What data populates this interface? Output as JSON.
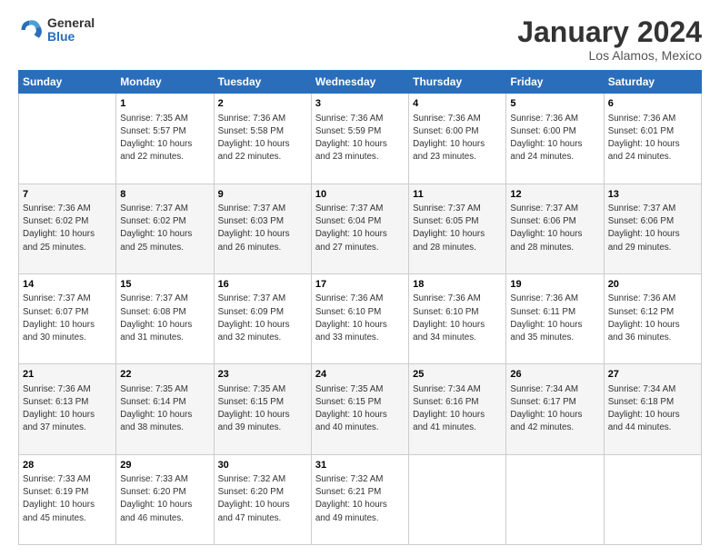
{
  "logo": {
    "general": "General",
    "blue": "Blue"
  },
  "title": "January 2024",
  "location": "Los Alamos, Mexico",
  "days_header": [
    "Sunday",
    "Monday",
    "Tuesday",
    "Wednesday",
    "Thursday",
    "Friday",
    "Saturday"
  ],
  "weeks": [
    [
      {
        "day": "",
        "info": ""
      },
      {
        "day": "1",
        "info": "Sunrise: 7:35 AM\nSunset: 5:57 PM\nDaylight: 10 hours\nand 22 minutes."
      },
      {
        "day": "2",
        "info": "Sunrise: 7:36 AM\nSunset: 5:58 PM\nDaylight: 10 hours\nand 22 minutes."
      },
      {
        "day": "3",
        "info": "Sunrise: 7:36 AM\nSunset: 5:59 PM\nDaylight: 10 hours\nand 23 minutes."
      },
      {
        "day": "4",
        "info": "Sunrise: 7:36 AM\nSunset: 6:00 PM\nDaylight: 10 hours\nand 23 minutes."
      },
      {
        "day": "5",
        "info": "Sunrise: 7:36 AM\nSunset: 6:00 PM\nDaylight: 10 hours\nand 24 minutes."
      },
      {
        "day": "6",
        "info": "Sunrise: 7:36 AM\nSunset: 6:01 PM\nDaylight: 10 hours\nand 24 minutes."
      }
    ],
    [
      {
        "day": "7",
        "info": "Sunrise: 7:36 AM\nSunset: 6:02 PM\nDaylight: 10 hours\nand 25 minutes."
      },
      {
        "day": "8",
        "info": "Sunrise: 7:37 AM\nSunset: 6:02 PM\nDaylight: 10 hours\nand 25 minutes."
      },
      {
        "day": "9",
        "info": "Sunrise: 7:37 AM\nSunset: 6:03 PM\nDaylight: 10 hours\nand 26 minutes."
      },
      {
        "day": "10",
        "info": "Sunrise: 7:37 AM\nSunset: 6:04 PM\nDaylight: 10 hours\nand 27 minutes."
      },
      {
        "day": "11",
        "info": "Sunrise: 7:37 AM\nSunset: 6:05 PM\nDaylight: 10 hours\nand 28 minutes."
      },
      {
        "day": "12",
        "info": "Sunrise: 7:37 AM\nSunset: 6:06 PM\nDaylight: 10 hours\nand 28 minutes."
      },
      {
        "day": "13",
        "info": "Sunrise: 7:37 AM\nSunset: 6:06 PM\nDaylight: 10 hours\nand 29 minutes."
      }
    ],
    [
      {
        "day": "14",
        "info": "Sunrise: 7:37 AM\nSunset: 6:07 PM\nDaylight: 10 hours\nand 30 minutes."
      },
      {
        "day": "15",
        "info": "Sunrise: 7:37 AM\nSunset: 6:08 PM\nDaylight: 10 hours\nand 31 minutes."
      },
      {
        "day": "16",
        "info": "Sunrise: 7:37 AM\nSunset: 6:09 PM\nDaylight: 10 hours\nand 32 minutes."
      },
      {
        "day": "17",
        "info": "Sunrise: 7:36 AM\nSunset: 6:10 PM\nDaylight: 10 hours\nand 33 minutes."
      },
      {
        "day": "18",
        "info": "Sunrise: 7:36 AM\nSunset: 6:10 PM\nDaylight: 10 hours\nand 34 minutes."
      },
      {
        "day": "19",
        "info": "Sunrise: 7:36 AM\nSunset: 6:11 PM\nDaylight: 10 hours\nand 35 minutes."
      },
      {
        "day": "20",
        "info": "Sunrise: 7:36 AM\nSunset: 6:12 PM\nDaylight: 10 hours\nand 36 minutes."
      }
    ],
    [
      {
        "day": "21",
        "info": "Sunrise: 7:36 AM\nSunset: 6:13 PM\nDaylight: 10 hours\nand 37 minutes."
      },
      {
        "day": "22",
        "info": "Sunrise: 7:35 AM\nSunset: 6:14 PM\nDaylight: 10 hours\nand 38 minutes."
      },
      {
        "day": "23",
        "info": "Sunrise: 7:35 AM\nSunset: 6:15 PM\nDaylight: 10 hours\nand 39 minutes."
      },
      {
        "day": "24",
        "info": "Sunrise: 7:35 AM\nSunset: 6:15 PM\nDaylight: 10 hours\nand 40 minutes."
      },
      {
        "day": "25",
        "info": "Sunrise: 7:34 AM\nSunset: 6:16 PM\nDaylight: 10 hours\nand 41 minutes."
      },
      {
        "day": "26",
        "info": "Sunrise: 7:34 AM\nSunset: 6:17 PM\nDaylight: 10 hours\nand 42 minutes."
      },
      {
        "day": "27",
        "info": "Sunrise: 7:34 AM\nSunset: 6:18 PM\nDaylight: 10 hours\nand 44 minutes."
      }
    ],
    [
      {
        "day": "28",
        "info": "Sunrise: 7:33 AM\nSunset: 6:19 PM\nDaylight: 10 hours\nand 45 minutes."
      },
      {
        "day": "29",
        "info": "Sunrise: 7:33 AM\nSunset: 6:20 PM\nDaylight: 10 hours\nand 46 minutes."
      },
      {
        "day": "30",
        "info": "Sunrise: 7:32 AM\nSunset: 6:20 PM\nDaylight: 10 hours\nand 47 minutes."
      },
      {
        "day": "31",
        "info": "Sunrise: 7:32 AM\nSunset: 6:21 PM\nDaylight: 10 hours\nand 49 minutes."
      },
      {
        "day": "",
        "info": ""
      },
      {
        "day": "",
        "info": ""
      },
      {
        "day": "",
        "info": ""
      }
    ]
  ]
}
